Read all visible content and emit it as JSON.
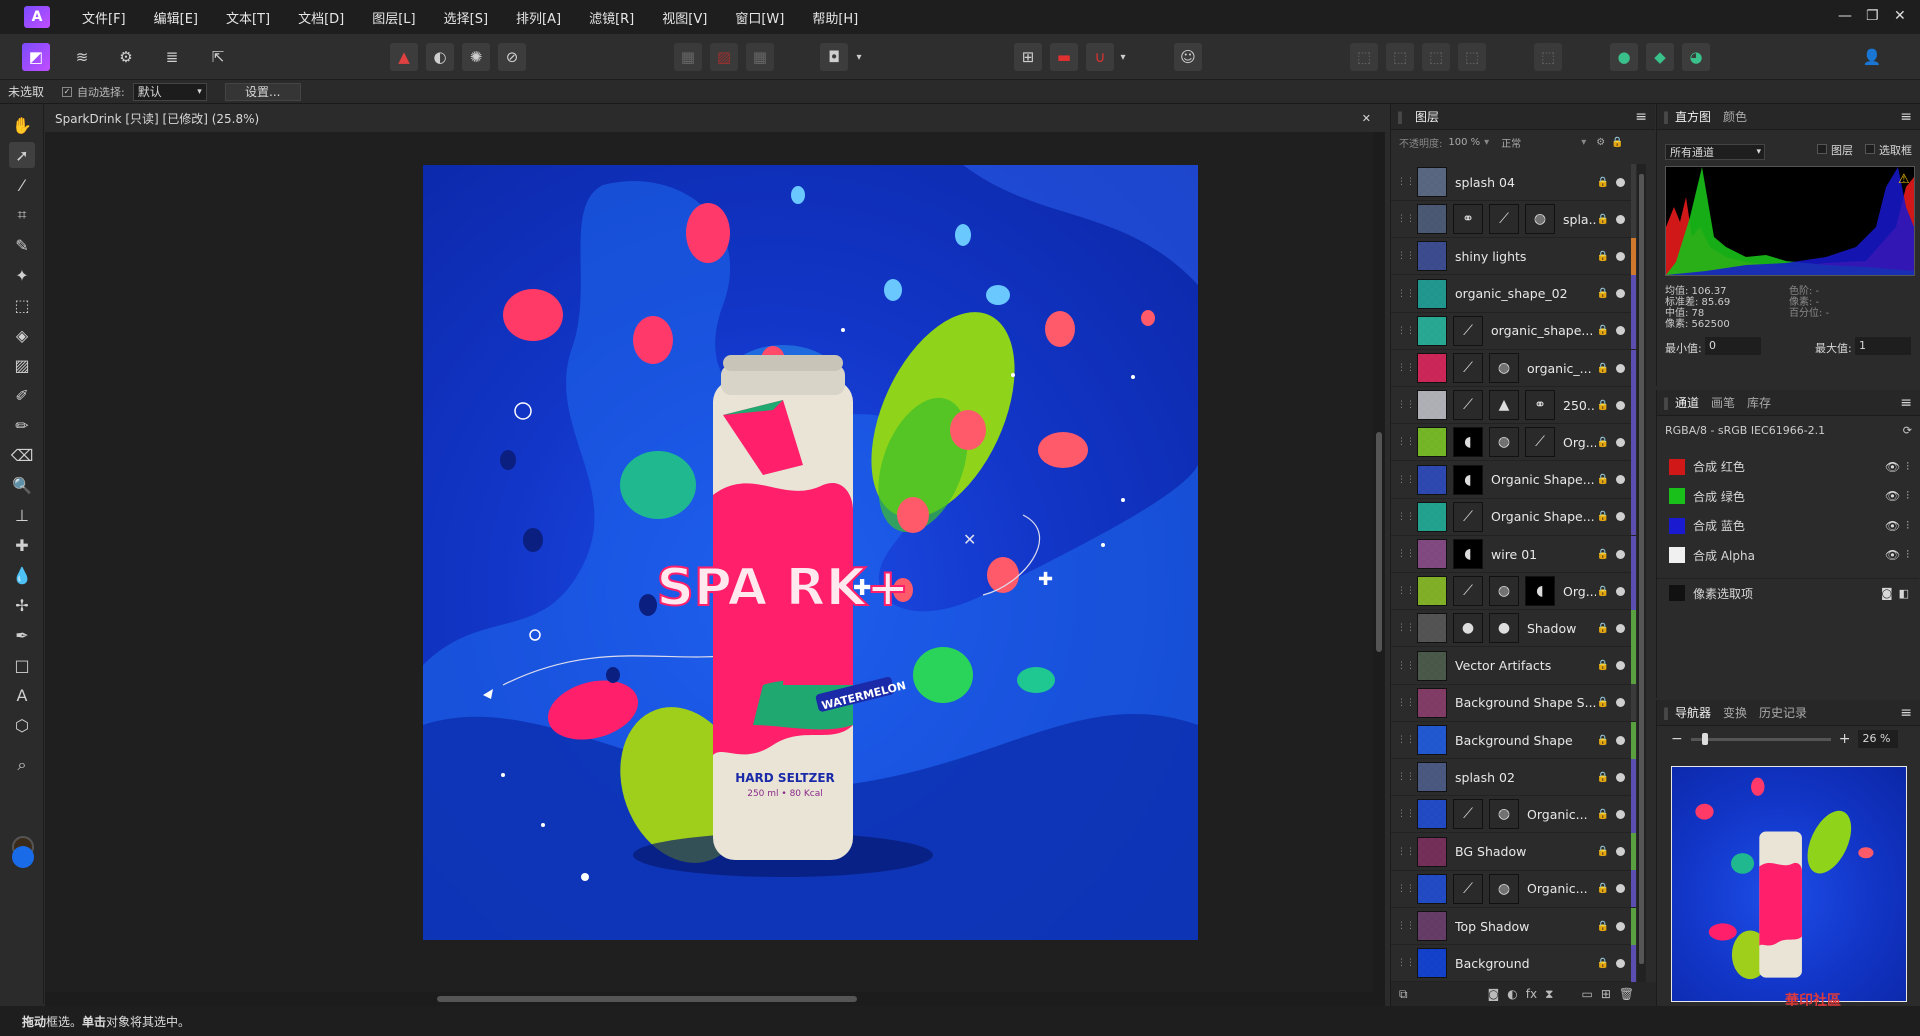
{
  "menu": [
    "文件[F]",
    "编辑[E]",
    "文本[T]",
    "文档[D]",
    "图层[L]",
    "选择[S]",
    "排列[A]",
    "滤镜[R]",
    "视图[V]",
    "窗口[W]",
    "帮助[H]"
  ],
  "context": {
    "selection": "未选取",
    "auto_select_label": "自动选择:",
    "auto_select_value": "默认",
    "settings_button": "设置..."
  },
  "document": {
    "tab_title": "SparkDrink [只读] [已修改] (25.8%)"
  },
  "layers_panel": {
    "tab": "图层",
    "opacity_label": "不透明度:",
    "opacity_value": "100 %",
    "blend_mode": "正常",
    "layers": [
      {
        "name": "splash 04",
        "thumb": "#5a6b8a",
        "stripe": "#3a3a3a",
        "subs": []
      },
      {
        "name": "spla...",
        "thumb": "#4a5a7a",
        "stripe": "#3a3a3a",
        "subs": [
          "node-icon",
          "curve-icon",
          "stripes-icon"
        ]
      },
      {
        "name": "shiny lights",
        "thumb": "#3a4a9a",
        "stripe": "#d0782c",
        "subs": []
      },
      {
        "name": "organic_shape_02",
        "thumb": "#1aa39a",
        "stripe": "#5a4fb0",
        "subs": []
      },
      {
        "name": "organic_shape...",
        "thumb": "#22b89f",
        "stripe": "#5a4fb0",
        "subs": [
          "curve-icon"
        ]
      },
      {
        "name": "organic_...",
        "thumb": "#e0205a",
        "stripe": "#5a4fb0",
        "subs": [
          "curve-icon",
          "stripes-icon"
        ]
      },
      {
        "name": "250...",
        "thumb": "#c0c0c8",
        "stripe": "#5a4fb0",
        "subs": [
          "curve-icon",
          "levels-icon",
          "node-icon"
        ]
      },
      {
        "name": "Org...",
        "thumb": "#7ac820",
        "stripe": "#5a4fb0",
        "subs": [
          "mask-icon",
          "stripes-icon",
          "curve-icon"
        ]
      },
      {
        "name": "Organic Shape...",
        "thumb": "#2848c0",
        "stripe": "#5a4fb0",
        "subs": [
          "mask-icon"
        ]
      },
      {
        "name": "Organic Shape...",
        "thumb": "#1ab09a",
        "stripe": "#5a4fb0",
        "subs": [
          "curve-icon"
        ]
      },
      {
        "name": "wire 01",
        "thumb": "#8a4a8a",
        "stripe": "#5a4fb0",
        "subs": [
          "mask-icon"
        ]
      },
      {
        "name": "Org...",
        "thumb": "#8ac020",
        "stripe": "#5a4fb0",
        "subs": [
          "curve-icon",
          "stripes-icon",
          "mask-icon"
        ]
      },
      {
        "name": "Shadow",
        "thumb": "#555",
        "stripe": "#5aa040",
        "subs": [
          "glow-icon",
          "glow-icon"
        ]
      },
      {
        "name": "Vector Artifacts",
        "thumb": "#4a5a4a",
        "stripe": "#5aa040",
        "subs": []
      },
      {
        "name": "Background Shape S...",
        "thumb": "#8a3a6a",
        "stripe": "#3a3a3a",
        "subs": []
      },
      {
        "name": "Background Shape",
        "thumb": "#1a5ae8",
        "stripe": "#5aa040",
        "subs": []
      },
      {
        "name": "splash 02",
        "thumb": "#4a5a8a",
        "stripe": "#5a4fb0",
        "subs": []
      },
      {
        "name": "Organic...",
        "thumb": "#1a4ad8",
        "stripe": "#5a4fb0",
        "subs": [
          "curve-icon",
          "stripes-icon"
        ]
      },
      {
        "name": "BG Shadow",
        "thumb": "#7a2a5a",
        "stripe": "#5aa040",
        "subs": []
      },
      {
        "name": "Organic...",
        "thumb": "#1a4ad8",
        "stripe": "#5a4fb0",
        "subs": [
          "curve-icon",
          "stripes-icon"
        ]
      },
      {
        "name": "Top Shadow",
        "thumb": "#6a3a6a",
        "stripe": "#5aa040",
        "subs": []
      },
      {
        "name": "Background",
        "thumb": "#0b3fe0",
        "stripe": "#5a4fb0",
        "subs": []
      }
    ]
  },
  "histogram_panel": {
    "tabs": [
      "直方图",
      "颜色"
    ],
    "channel_select": "所有通道",
    "opt_layer": "图层",
    "opt_marquee": "选取框",
    "stats_left": [
      "均值: 106.37",
      "标准差: 85.69",
      "中值: 78",
      "像素: 562500"
    ],
    "stats_right": [
      "色阶: -",
      "像素: -",
      "百分位: -"
    ],
    "min_label": "最小值:",
    "min_value": "0",
    "max_label": "最大值:",
    "max_value": "1"
  },
  "channels_panel": {
    "tabs": [
      "通道",
      "画笔",
      "库存"
    ],
    "profile": "RGBA/8 - sRGB IEC61966-2.1",
    "channels": [
      {
        "name": "合成 红色",
        "color": "#d01818"
      },
      {
        "name": "合成 绿色",
        "color": "#1ac01a"
      },
      {
        "name": "合成 蓝色",
        "color": "#1a1ad0"
      },
      {
        "name": "合成 Alpha",
        "color": "#f0f0f0"
      },
      {
        "name": "像素选取项",
        "color": "#111111"
      }
    ]
  },
  "navigator_panel": {
    "tabs": [
      "导航器",
      "变换",
      "历史记录"
    ],
    "zoom": "26 %",
    "zoom_level": 0.26
  },
  "can_text": {
    "brand": "SPA RK+",
    "flavor": "WATERMELON",
    "type": "HARD SELTZER",
    "info": "250 ml • 80 Kcal"
  },
  "status": {
    "bold1": "拖动",
    "text1": " 框选。",
    "bold2": "单击",
    "text2": " 对象将其选中。"
  },
  "watermark": "華印社區",
  "colors": {
    "accent": "#1a6be8",
    "canvas_bg": "#1236c8"
  }
}
